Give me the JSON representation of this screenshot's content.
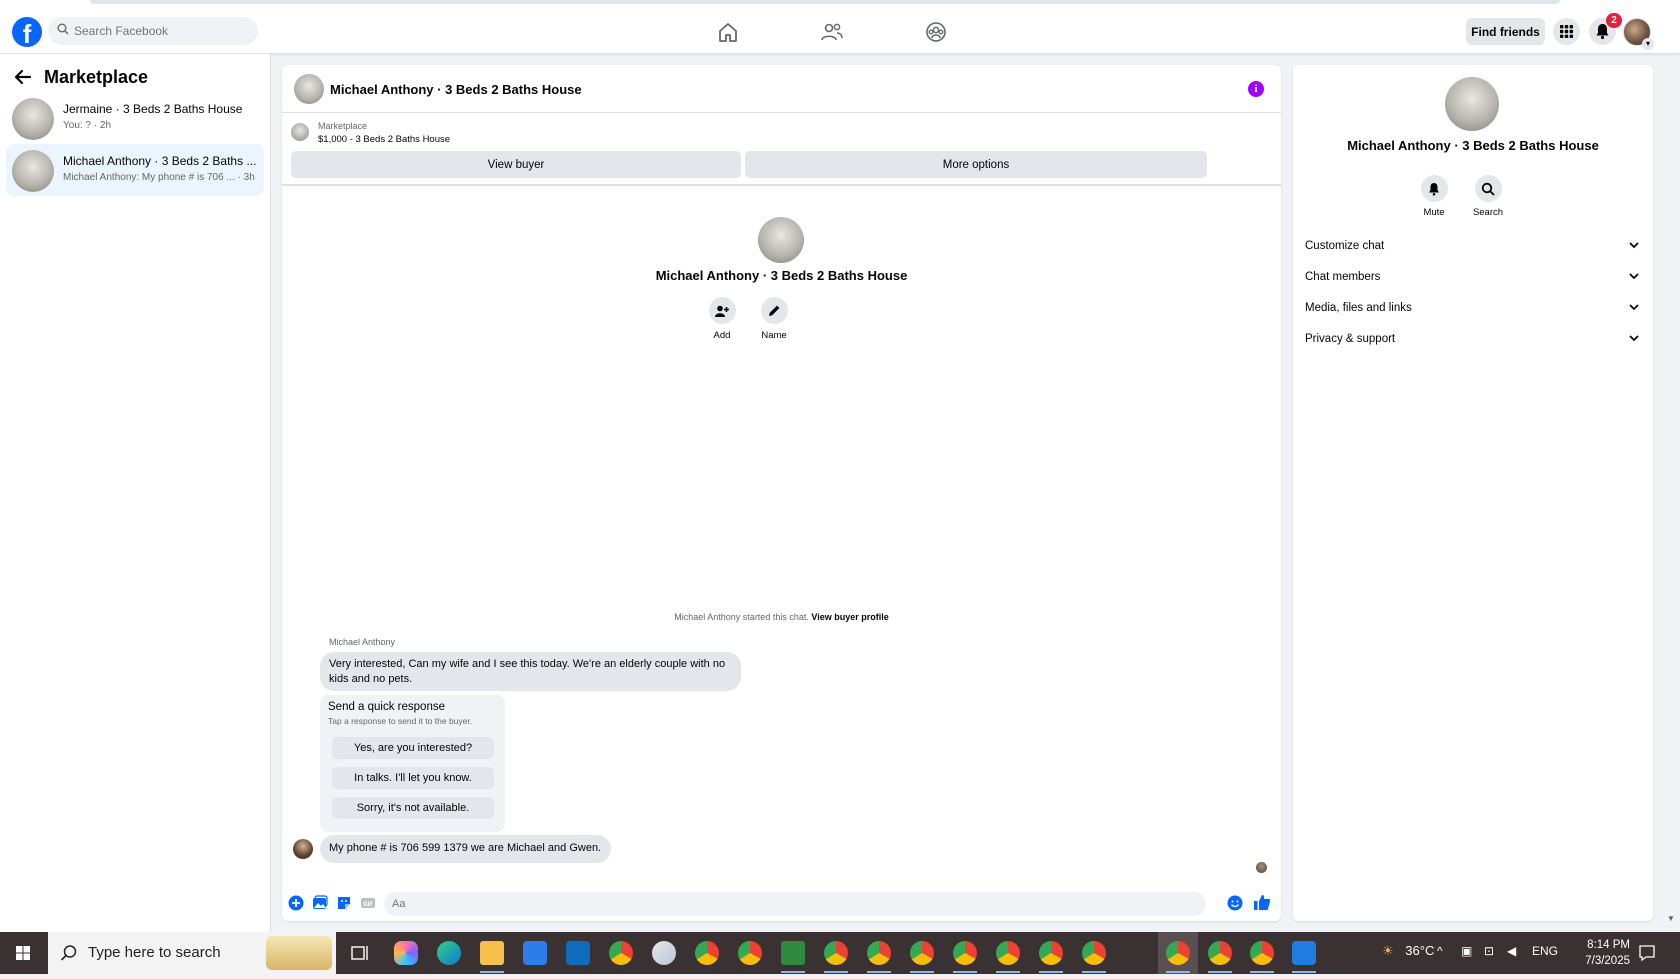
{
  "topnav": {
    "search_placeholder": "Search Facebook",
    "find_friends_label": "Find friends",
    "notification_count": "2"
  },
  "sidebar": {
    "title": "Marketplace",
    "conversations": [
      {
        "name": "Jermaine · 3 Beds 2 Baths House",
        "preview": "You: ? · 2h"
      },
      {
        "name": "Michael Anthony · 3 Beds 2 Baths ...",
        "preview": "Michael Anthony: My phone # is 706 ... · 3h"
      }
    ]
  },
  "chat": {
    "title": "Michael Anthony · 3 Beds 2 Baths House",
    "marketplace_label": "Marketplace",
    "listing": "$1,000 - 3 Beds 2 Baths House",
    "view_buyer_label": "View buyer",
    "more_options_label": "More options",
    "intro_name": "Michael Anthony · 3 Beds 2 Baths House",
    "intro_actions": {
      "add_label": "Add",
      "name_label": "Name"
    },
    "started_text": "Michael Anthony started this chat.",
    "view_profile_link": "View buyer profile",
    "sender_name": "Michael Anthony",
    "message_1": "Very interested, Can my wife and I see this today. We're an elderly couple with no kids and no pets.",
    "quick_response": {
      "heading": "Send a quick response",
      "hint": "Tap a response to send it to the buyer.",
      "options": [
        "Yes, are you interested?",
        "In talks. I'll let you know.",
        "Sorry, it's not available."
      ]
    },
    "message_2": "My phone # is 706 599 1379 we are Michael and Gwen.",
    "composer_placeholder": "Aa"
  },
  "details": {
    "name": "Michael Anthony · 3 Beds 2 Baths House",
    "mute_label": "Mute",
    "search_label": "Search",
    "sections": [
      "Customize chat",
      "Chat members",
      "Media, files and links",
      "Privacy & support"
    ]
  },
  "taskbar": {
    "search_text": "Type here to search",
    "temperature": "36°C",
    "language": "ENG",
    "time": "8:14 PM",
    "date": "7/3/2025"
  },
  "colors": {
    "brand": "#0866ff",
    "info": "#a100ff",
    "badge": "#e41e3f",
    "taskbar": "#3a3133"
  }
}
